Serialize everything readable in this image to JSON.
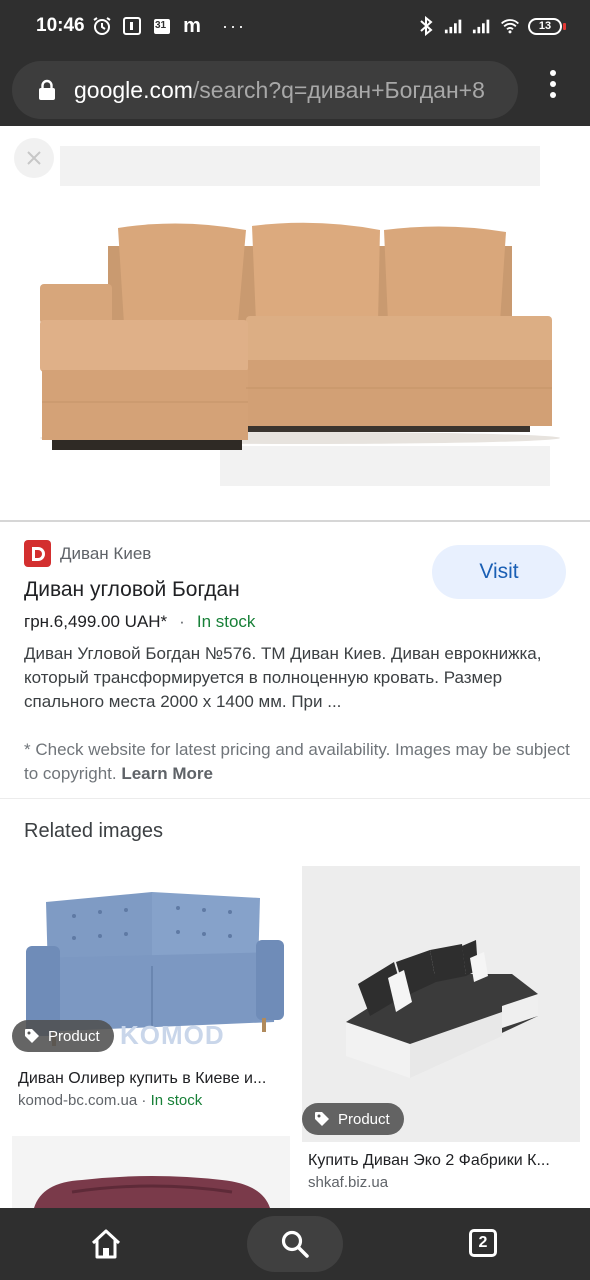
{
  "status_bar": {
    "time": "10:46",
    "calendar_day": "31",
    "app_letter": "m",
    "more": "···",
    "battery": "13"
  },
  "browser": {
    "url_domain": "google.com",
    "url_path": "/search?q=диван+Богдан+8"
  },
  "result": {
    "source": "Диван Киев",
    "favicon_letter": "D",
    "title": "Диван угловой Богдан",
    "price": "грн.6,499.00 UAH*",
    "separator": "·",
    "availability": "In stock",
    "description": "Диван Угловой Богдан №576. ТМ Диван Киев. Диван еврокнижка, который трансформируется в полноценную кровать. Размер спального места 2000 х 1400 мм. При ...",
    "visit_label": "Visit",
    "disclaimer": "* Check website for latest pricing and availability. Images may be subject to copyright.",
    "learn_more": "Learn More"
  },
  "related": {
    "heading": "Related images",
    "items": [
      {
        "badge": "Product",
        "title": "Диван Оливер купить в Киеве и...",
        "site": "komod-bc.com.ua",
        "availability": "In stock",
        "watermark": "KOMOD"
      },
      {
        "badge": "Product",
        "title": "Купить Диван Эко 2 Фабрики К...",
        "site": "shkaf.biz.ua",
        "availability": ""
      }
    ]
  },
  "bottom_nav": {
    "tab_count": "2"
  },
  "colors": {
    "chrome_bg": "#2f2f2f",
    "visit_bg": "#e8f0fe",
    "visit_text": "#1a5fb4",
    "in_stock": "#188038",
    "sofa_main": "#d6a57a"
  }
}
